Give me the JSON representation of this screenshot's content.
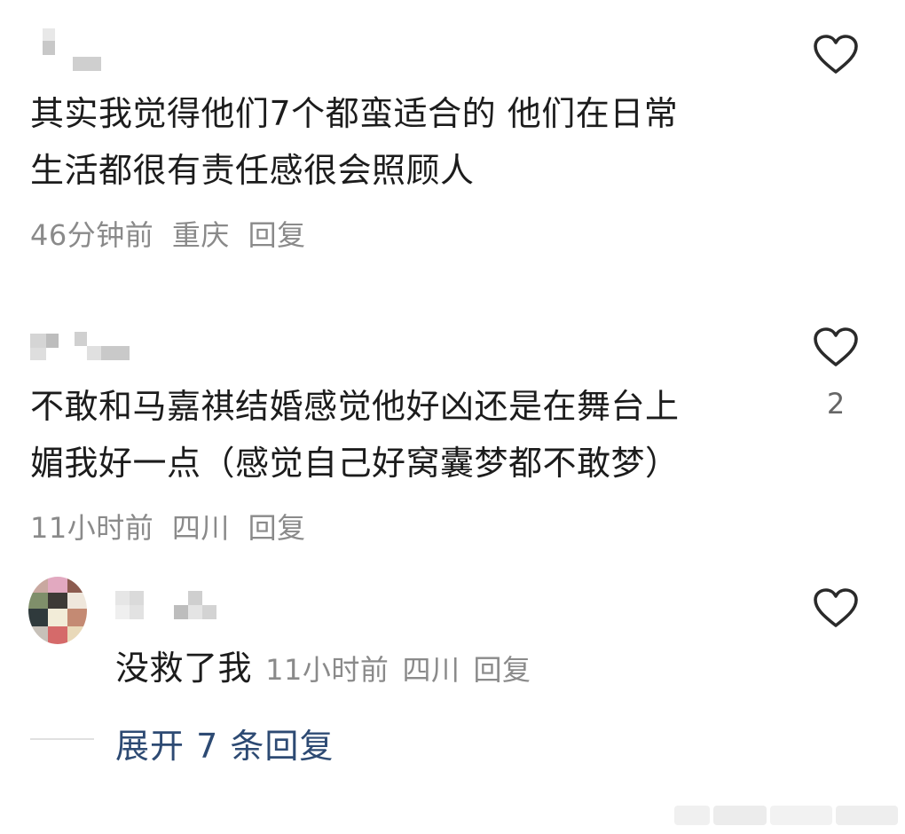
{
  "comments": [
    {
      "username": "",
      "text_lines": [
        "其实我觉得他们7个都蛮适合的 他们在日常",
        "生活都很有责任感很会照顾人"
      ],
      "time": "46分钟前",
      "location": "重庆",
      "reply_label": "回复",
      "likes": ""
    },
    {
      "username": "",
      "text_lines": [
        "不敢和马嘉祺结婚感觉他好凶还是在舞台上",
        "媚我好一点（感觉自己好窝囊梦都不敢梦）"
      ],
      "time": "11小时前",
      "location": "四川",
      "reply_label": "回复",
      "likes": "2"
    }
  ],
  "reply": {
    "username": "",
    "text": "没救了我",
    "time": "11小时前",
    "location": "四川",
    "reply_label": "回复"
  },
  "expand": {
    "label": "展开 7 条回复"
  },
  "colors": {
    "accent_link": "#2d4a73",
    "meta_gray": "#8a8a8a"
  },
  "icons": [
    "heart-outline-icon",
    "avatar-image"
  ]
}
